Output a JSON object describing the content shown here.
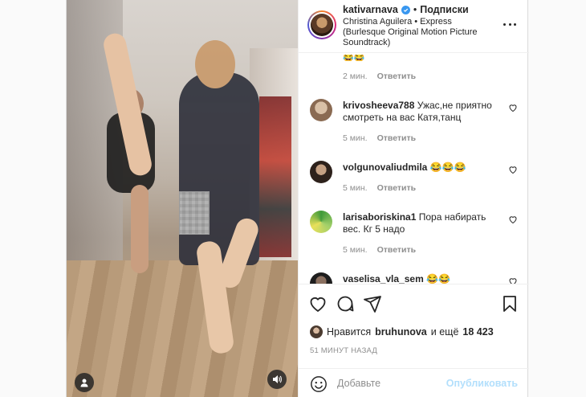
{
  "post": {
    "username": "kativarnava",
    "follow_label": "Подписки",
    "audio_track": "Christina Aguilera • Express (Burlesque Original Motion Picture Soundtrack)",
    "top_comment_emoji": "😂😂",
    "top_comment_time": "2 мин.",
    "reply_label": "Ответить"
  },
  "comments": [
    {
      "username": "krivosheeva788",
      "text": "Ужас,не приятно смотреть на вас Катя,танц",
      "time": "5 мин.",
      "reply": "Ответить",
      "avatar_color": "#b08a6a"
    },
    {
      "username": "volgunovaliudmila",
      "text": "😂😂😂",
      "time": "5 мин.",
      "reply": "Ответить",
      "avatar_color": "#3a2a22"
    },
    {
      "username": "larisaboriskina1",
      "text": "Пора набирать вес. Кг 5 надо",
      "time": "5 мин.",
      "reply": "Ответить",
      "avatar_color": "#5aa84a"
    },
    {
      "username": "vaselisa_vla_sem",
      "text": "😂😂",
      "time": "",
      "reply": "",
      "avatar_color": "#2c2c2c"
    }
  ],
  "likes": {
    "prefix": "Нравится",
    "user": "bruhunova",
    "middle": "и ещё",
    "count": "18 423"
  },
  "timestamp": "51 МИНУТ НАЗАД",
  "add_comment": {
    "placeholder": "Добавьте",
    "post_label": "Опубликовать"
  },
  "colors": {
    "verified": "#3897f0",
    "post_button_disabled": "#b2dffc",
    "meta_gray": "#8e8e8e"
  },
  "icons": [
    "user-tag-icon",
    "sound-icon",
    "heart-icon",
    "comment-icon",
    "share-icon",
    "bookmark-icon",
    "emoji-icon",
    "more-options-icon",
    "verified-badge-icon"
  ]
}
